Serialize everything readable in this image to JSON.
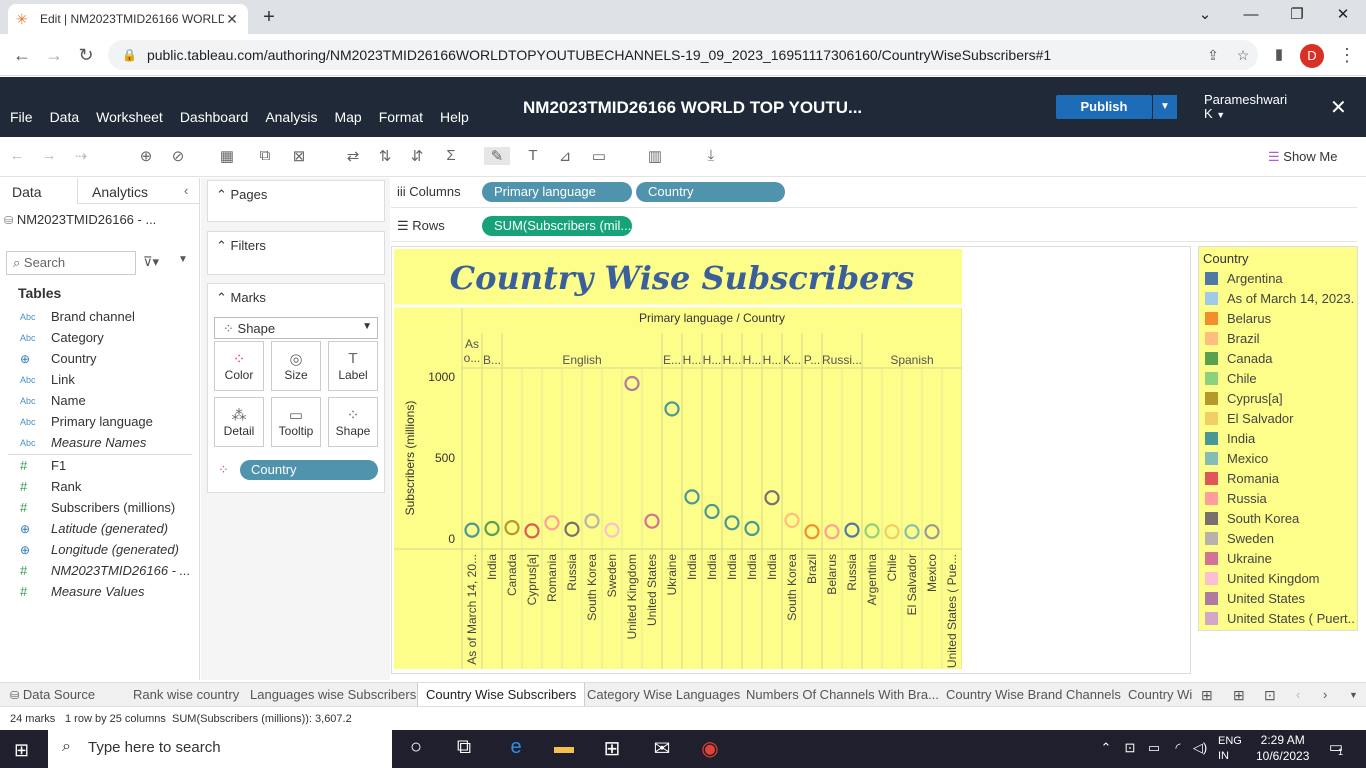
{
  "browser": {
    "tab_title": "Edit | NM2023TMID26166 WORLD",
    "url": "public.tableau.com/authoring/NM2023TMID26166WORLDTOPYOUTUBECHANNELS-19_09_2023_16951117306160/CountryWiseSubscribers#1",
    "profile_initial": "D"
  },
  "tableau": {
    "menus": [
      "File",
      "Data",
      "Worksheet",
      "Dashboard",
      "Analysis",
      "Map",
      "Format",
      "Help"
    ],
    "workbook_title": "NM2023TMID26166 WORLD TOP YOUTU...",
    "publish_label": "Publish",
    "user_name": "Parameshwari K",
    "show_me": "Show Me"
  },
  "data_pane": {
    "tab_data": "Data",
    "tab_analytics": "Analytics",
    "datasource": "NM2023TMID26166 - ...",
    "search_placeholder": "Search",
    "tables_heading": "Tables",
    "fields": [
      {
        "type": "Abc",
        "name": "Brand channel",
        "italic": false
      },
      {
        "type": "Abc",
        "name": "Category",
        "italic": false
      },
      {
        "type": "geo",
        "name": "Country",
        "italic": false
      },
      {
        "type": "Abc",
        "name": "Link",
        "italic": false
      },
      {
        "type": "Abc",
        "name": "Name",
        "italic": false
      },
      {
        "type": "Abc",
        "name": "Primary language",
        "italic": false
      },
      {
        "type": "Abc",
        "name": "Measure Names",
        "italic": true
      },
      {
        "type": "#",
        "name": "F1",
        "italic": false
      },
      {
        "type": "#",
        "name": "Rank",
        "italic": false
      },
      {
        "type": "#",
        "name": "Subscribers (millions)",
        "italic": false
      },
      {
        "type": "geo",
        "name": "Latitude (generated)",
        "italic": true
      },
      {
        "type": "geo",
        "name": "Longitude (generated)",
        "italic": true
      },
      {
        "type": "#",
        "name": "NM2023TMID26166 - ...",
        "italic": true
      },
      {
        "type": "#",
        "name": "Measure Values",
        "italic": true
      }
    ]
  },
  "cards": {
    "pages": "Pages",
    "filters": "Filters",
    "marks": "Marks",
    "mark_type": "Shape",
    "buttons": [
      "Color",
      "Size",
      "Label",
      "Detail",
      "Tooltip",
      "Shape"
    ],
    "color_pill": "Country"
  },
  "shelves": {
    "columns_label": "Columns",
    "rows_label": "Rows",
    "columns": [
      "Primary language",
      "Country"
    ],
    "rows": [
      "SUM(Subscribers (mil..."
    ]
  },
  "chart_data": {
    "type": "scatter",
    "title": "Country Wise Subscribers",
    "header": "Primary language / Country",
    "ylabel": "Subscribers (millions)",
    "ylim": [
      0,
      1050
    ],
    "yticks": [
      0,
      500,
      1000
    ],
    "groups": [
      {
        "language": "As o...",
        "countries": [
          "As of March 14, 20..."
        ]
      },
      {
        "language": "B...",
        "countries": [
          "India"
        ]
      },
      {
        "language": "English",
        "countries": [
          "Canada",
          "Cyprus[a]",
          "Romania",
          "Russia",
          "South Korea",
          "Sweden",
          "United Kingdom",
          "United States"
        ]
      },
      {
        "language": "E...",
        "countries": [
          "Ukraine"
        ]
      },
      {
        "language": "H...",
        "countries": [
          "India"
        ]
      },
      {
        "language": "H...",
        "countries": [
          "India"
        ]
      },
      {
        "language": "H...",
        "countries": [
          "India"
        ]
      },
      {
        "language": "H...",
        "countries": [
          "India"
        ]
      },
      {
        "language": "H...",
        "countries": [
          "India"
        ]
      },
      {
        "language": "K...",
        "countries": [
          "South Korea"
        ]
      },
      {
        "language": "P...",
        "countries": [
          "Brazil"
        ]
      },
      {
        "language": "Russi...",
        "countries": [
          "Belarus",
          "Russia"
        ]
      },
      {
        "language": "Spanish",
        "countries": [
          "Argentina",
          "Chile",
          "El Salvador",
          "Mexico",
          "United States ( Pue..."
        ]
      }
    ],
    "points": [
      {
        "col": 1,
        "country": "India",
        "value": 55
      },
      {
        "col": 2,
        "country": "Canada",
        "value": 65
      },
      {
        "col": 3,
        "country": "Cyprus[a]",
        "value": 70
      },
      {
        "col": 4,
        "country": "Romania",
        "value": 50
      },
      {
        "col": 5,
        "country": "Russia",
        "value": 100
      },
      {
        "col": 6,
        "country": "South Korea",
        "value": 60
      },
      {
        "col": 7,
        "country": "Sweden",
        "value": 111
      },
      {
        "col": 8,
        "country": "United Kingdom",
        "value": 55
      },
      {
        "col": 9,
        "country": "United States",
        "value": 960
      },
      {
        "col": 10,
        "country": "Ukraine",
        "value": 110
      },
      {
        "col": 11,
        "country": "India",
        "value": 803
      },
      {
        "col": 12,
        "country": "India",
        "value": 260
      },
      {
        "col": 13,
        "country": "India",
        "value": 170
      },
      {
        "col": 14,
        "country": "India",
        "value": 100
      },
      {
        "col": 15,
        "country": "India",
        "value": 65
      },
      {
        "col": 16,
        "country": "South Korea",
        "value": 255
      },
      {
        "col": 17,
        "country": "Brazil",
        "value": 115
      },
      {
        "col": 18,
        "country": "Belarus",
        "value": 45
      },
      {
        "col": 19,
        "country": "Russia",
        "value": 45
      },
      {
        "col": 20,
        "country": "Argentina",
        "value": 55
      },
      {
        "col": 21,
        "country": "Chile",
        "value": 50
      },
      {
        "col": 22,
        "country": "El Salvador",
        "value": 45
      },
      {
        "col": 23,
        "country": "Mexico",
        "value": 45
      },
      {
        "col": 24,
        "country": "United States ( Pue...",
        "value": 45
      }
    ],
    "legend_title": "Country",
    "legend": [
      {
        "name": "Argentina",
        "color": "#4e79a7"
      },
      {
        "name": "As of March 14, 2023...",
        "color": "#a0cbe8"
      },
      {
        "name": "Belarus",
        "color": "#f28e2b"
      },
      {
        "name": "Brazil",
        "color": "#ffbe7d"
      },
      {
        "name": "Canada",
        "color": "#59a14f"
      },
      {
        "name": "Chile",
        "color": "#8cd17d"
      },
      {
        "name": "Cyprus[a]",
        "color": "#b6992d"
      },
      {
        "name": "El Salvador",
        "color": "#f1ce63"
      },
      {
        "name": "India",
        "color": "#499894"
      },
      {
        "name": "Mexico",
        "color": "#86bcb6"
      },
      {
        "name": "Romania",
        "color": "#e15759"
      },
      {
        "name": "Russia",
        "color": "#ff9d9a"
      },
      {
        "name": "South Korea",
        "color": "#79706e"
      },
      {
        "name": "Sweden",
        "color": "#bab0ac"
      },
      {
        "name": "Ukraine",
        "color": "#d37295"
      },
      {
        "name": "United Kingdom",
        "color": "#fabfd2"
      },
      {
        "name": "United States",
        "color": "#b07aa1"
      },
      {
        "name": "United States ( Puert...",
        "color": "#d4a6c8"
      }
    ]
  },
  "sheet_tabs": [
    "Data Source",
    "Rank wise country",
    "Languages wise Subscribers",
    "Country Wise Subscribers",
    "Category Wise Languages",
    "Numbers Of Channels With Bra...",
    "Country Wise Brand Channels",
    "Country Wi"
  ],
  "active_sheet": "Country Wise Subscribers",
  "status": {
    "marks": "24 marks",
    "rows_cols": "1 row by 25 columns",
    "sum": "SUM(Subscribers (millions)): 3,607.2"
  },
  "taskbar": {
    "search_placeholder": "Type here to search",
    "lang1": "ENG",
    "lang2": "IN",
    "time": "2:29 AM",
    "date": "10/6/2023",
    "notif_count": "1"
  }
}
